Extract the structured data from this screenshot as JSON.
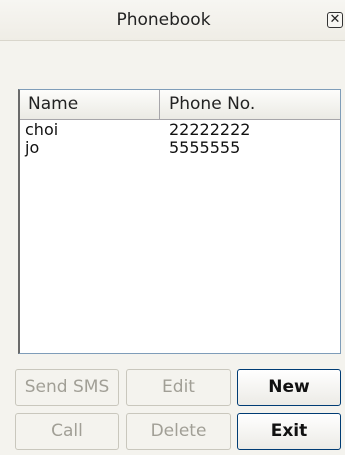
{
  "window": {
    "title": "Phonebook",
    "close_glyph": "✕"
  },
  "list": {
    "columns": [
      "Name",
      "Phone No."
    ],
    "rows": [
      {
        "name": "choi",
        "phone": "22222222"
      },
      {
        "name": "jo",
        "phone": "5555555"
      }
    ]
  },
  "buttons": {
    "send_sms": {
      "label": "Send SMS",
      "enabled": false
    },
    "edit": {
      "label": "Edit",
      "enabled": false
    },
    "new": {
      "label": "New",
      "enabled": true
    },
    "call": {
      "label": "Call",
      "enabled": false
    },
    "delete": {
      "label": "Delete",
      "enabled": false
    },
    "exit": {
      "label": "Exit",
      "enabled": true
    }
  }
}
